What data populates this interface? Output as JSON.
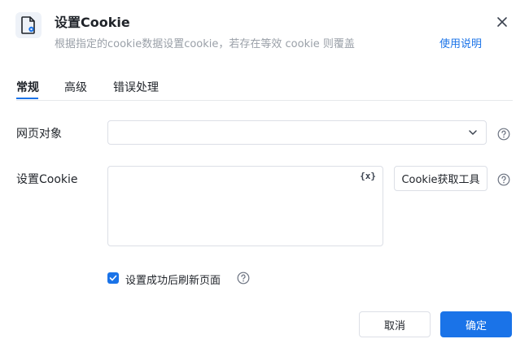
{
  "dialog": {
    "title": "设置Cookie",
    "subtitle": "根据指定的cookie数据设置cookie，若存在等效 cookie 则覆盖",
    "help_link": "使用说明"
  },
  "tabs": [
    {
      "label": "常规",
      "active": true
    },
    {
      "label": "高级",
      "active": false
    },
    {
      "label": "错误处理",
      "active": false
    }
  ],
  "form": {
    "page_object": {
      "label": "网页对象",
      "value": ""
    },
    "set_cookie": {
      "label": "设置Cookie",
      "value": "",
      "var_icon": "{x}",
      "tool_button": "Cookie获取工具"
    },
    "refresh_checkbox": {
      "label": "设置成功后刷新页面",
      "checked": true
    }
  },
  "footer": {
    "cancel": "取消",
    "confirm": "确定"
  },
  "colors": {
    "accent": "#1a73e8",
    "border": "#dcdfe6",
    "muted_text": "#9aa0a8"
  }
}
